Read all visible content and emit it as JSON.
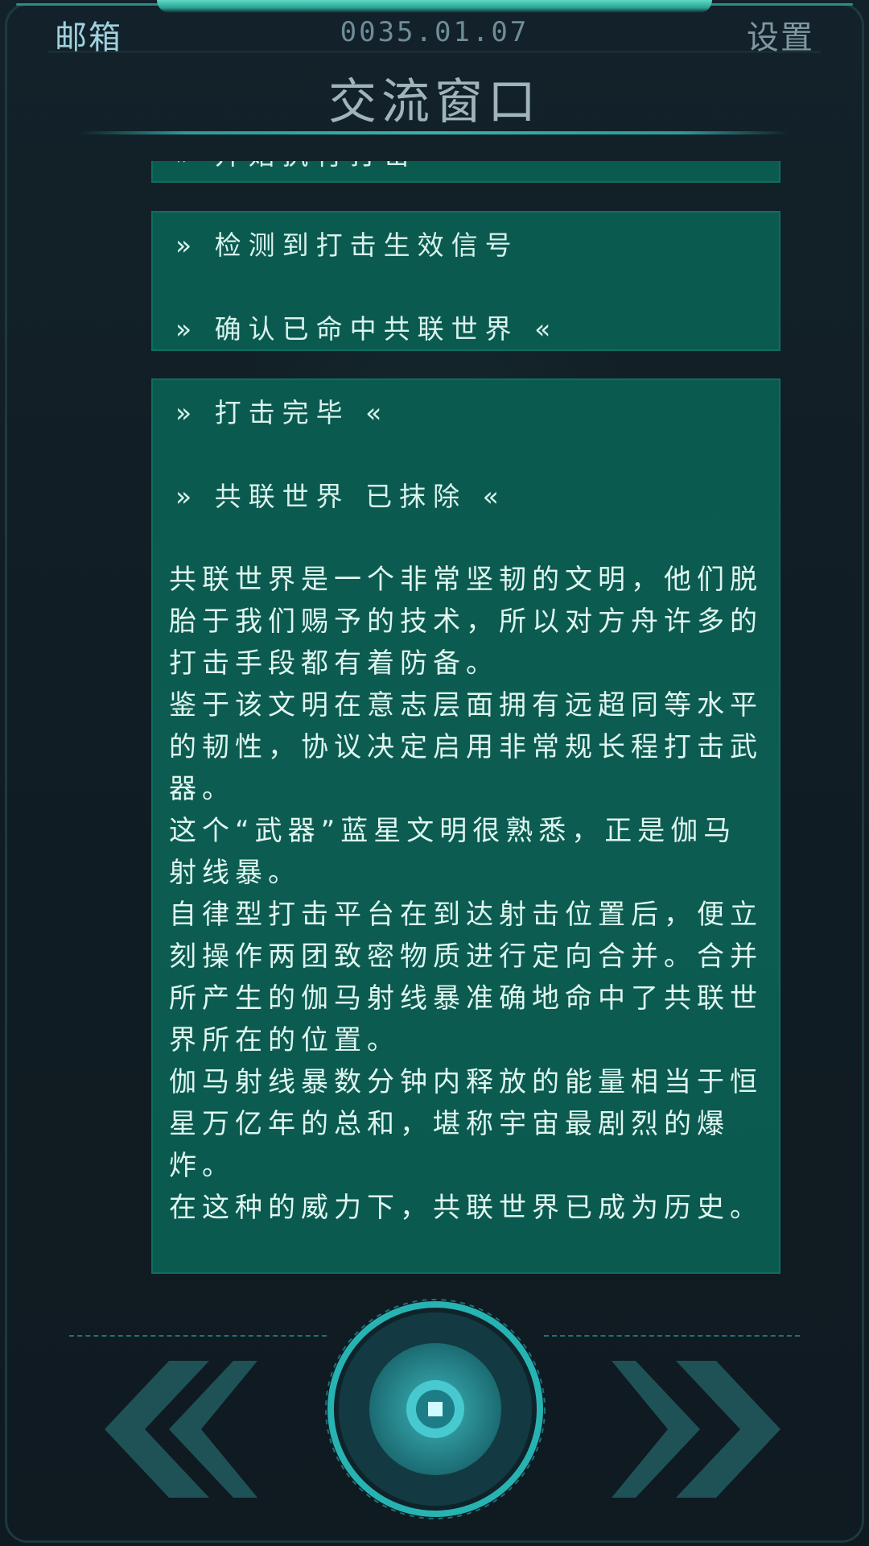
{
  "header": {
    "mail_label": "邮箱",
    "date": "0035.01.07",
    "settings_label": "设置",
    "title": "交流窗口"
  },
  "messages": [
    {
      "id": "partial",
      "lines": [
        "» 开始执行打击"
      ]
    },
    {
      "id": "signal",
      "lines": [
        "» 检测到打击生效信号",
        "» 确认已命中共联世界 «"
      ]
    },
    {
      "id": "report",
      "lines": [
        "» 打击完毕 «",
        "» 共联世界 已抹除 «"
      ],
      "paragraphs": [
        "共联世界是一个非常坚韧的文明，他们脱胎于我们赐予的技术，所以对方舟许多的打击手段都有着防备。",
        "鉴于该文明在意志层面拥有远超同等水平的韧性，协议决定启用非常规长程打击武器。",
        "这个“武器”蓝星文明很熟悉，正是伽马射线暴。",
        "自律型打击平台在到达射击位置后，便立刻操作两团致密物质进行定向合并。合并所产生的伽马射线暴准确地命中了共联世界所在的位置。",
        "伽马射线暴数分钟内释放的能量相当于恒星万亿年的总和，堪称宇宙最剧烈的爆炸。",
        "在这种的威力下，共联世界已成为历史。"
      ]
    }
  ],
  "controls": {
    "prev_icon": "double-chevron-left-icon",
    "next_icon": "double-chevron-right-icon",
    "center_icon": "stop-square-icon"
  },
  "colors": {
    "card_bg": "#0b5a50",
    "accent": "#2fb3ad",
    "text": "#d9f3ec",
    "chevron": "#1e5a60"
  }
}
